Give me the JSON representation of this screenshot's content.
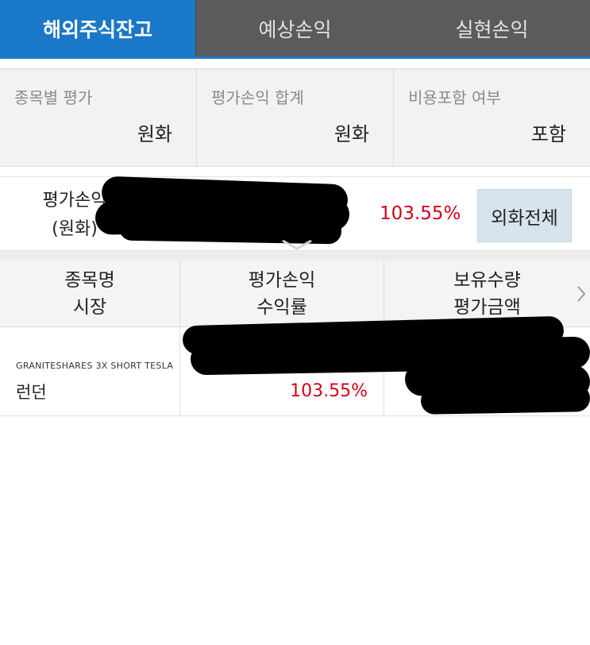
{
  "tabs": [
    {
      "label": "해외주식잔고",
      "active": true
    },
    {
      "label": "예상손익",
      "active": false
    },
    {
      "label": "실현손익",
      "active": false
    }
  ],
  "filters": [
    {
      "label": "종목별 평가",
      "value": "원화"
    },
    {
      "label": "평가손익 합계",
      "value": "원화"
    },
    {
      "label": "비용포함 여부",
      "value": "포함"
    }
  ],
  "summary": {
    "label_line1": "평가손익",
    "label_line2": "(원화)",
    "rate": "103.55%",
    "fx_button": "외화전체"
  },
  "table": {
    "headers": [
      {
        "line1": "종목명",
        "line2": "시장"
      },
      {
        "line1": "평가손익",
        "line2": "수익률"
      },
      {
        "line1": "보유수량",
        "line2": "평가금액"
      }
    ],
    "rows": [
      {
        "name": "GRANITESHARES 3X SHORT TESLA",
        "market": "런던",
        "rate": "103.55%"
      }
    ]
  },
  "colors": {
    "accent": "#1a78c8",
    "tab_inactive": "#5b5b5d",
    "loss_profit_red": "#d0021b"
  },
  "icons": [
    "chevron-down-icon",
    "chevron-right-icon"
  ]
}
